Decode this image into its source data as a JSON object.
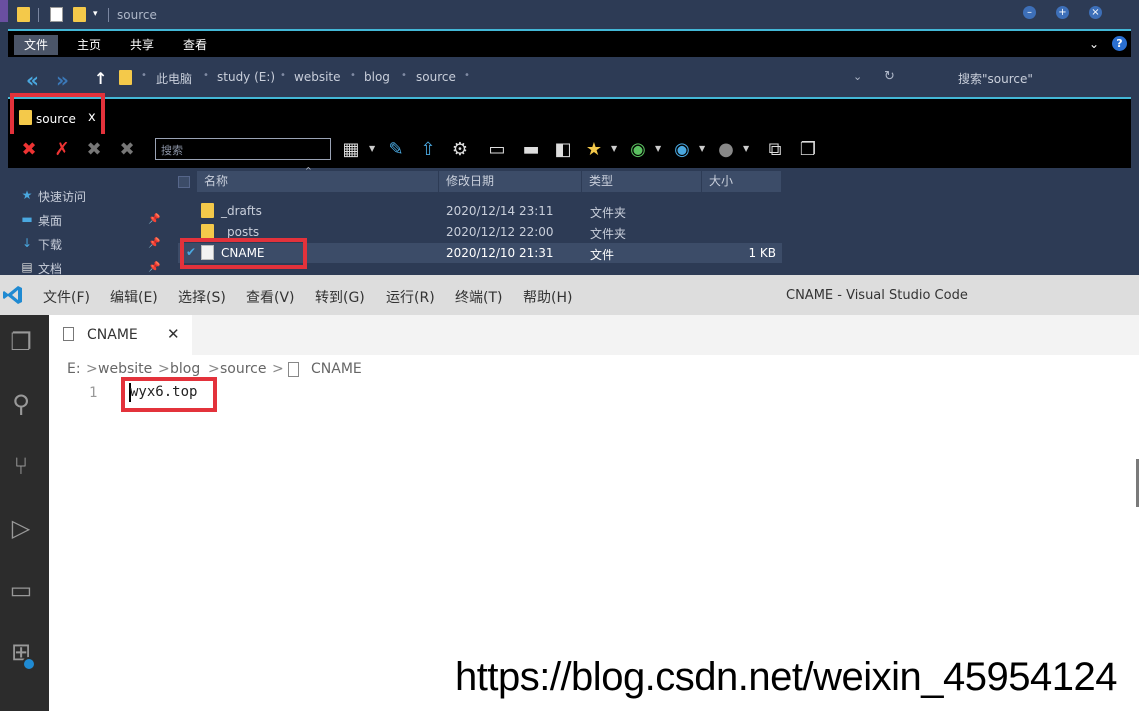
{
  "explorer": {
    "title": "source",
    "ribbon_tabs": [
      "文件",
      "主页",
      "共享",
      "查看"
    ],
    "address": {
      "crumbs": [
        "此电脑",
        "study (E:)",
        "website",
        "blog",
        "source"
      ],
      "search_placeholder": "搜索\"source\""
    },
    "tab": {
      "label": "source",
      "close": "x"
    },
    "toolbar_search_placeholder": "搜索",
    "nav": [
      {
        "label": "快速访问",
        "icon": "star-icon"
      },
      {
        "label": "桌面",
        "icon": "desktop-icon"
      },
      {
        "label": "下载",
        "icon": "download-icon"
      },
      {
        "label": "文档",
        "icon": "document-icon"
      }
    ],
    "columns": [
      "名称",
      "修改日期",
      "类型",
      "大小"
    ],
    "files": [
      {
        "name": "_drafts",
        "date": "2020/12/14 23:11",
        "type": "文件夹",
        "size": ""
      },
      {
        "name": "_posts",
        "date": "2020/12/12 22:00",
        "type": "文件夹",
        "size": ""
      },
      {
        "name": "CNAME",
        "date": "2020/12/10 21:31",
        "type": "文件",
        "size": "1 KB"
      }
    ],
    "colors": {
      "bg": "#2d3b55",
      "accent": "#43b7d6",
      "highlight": "#e3323b"
    }
  },
  "vscode": {
    "menu": [
      "文件(F)",
      "编辑(E)",
      "选择(S)",
      "查看(V)",
      "转到(G)",
      "运行(R)",
      "终端(T)",
      "帮助(H)"
    ],
    "window_title": "CNAME - Visual Studio Code",
    "tab": {
      "label": "CNAME",
      "close": "✕"
    },
    "breadcrumb": [
      "E:",
      "website",
      "blog",
      "source",
      "CNAME"
    ],
    "line_number": "1",
    "code": "wyx6.top",
    "activity_icons": [
      "files-icon",
      "search-icon",
      "source-control-icon",
      "run-debug-icon",
      "remote-explorer-icon",
      "extensions-icon"
    ]
  },
  "watermark": "https://blog.csdn.net/weixin_45954124"
}
